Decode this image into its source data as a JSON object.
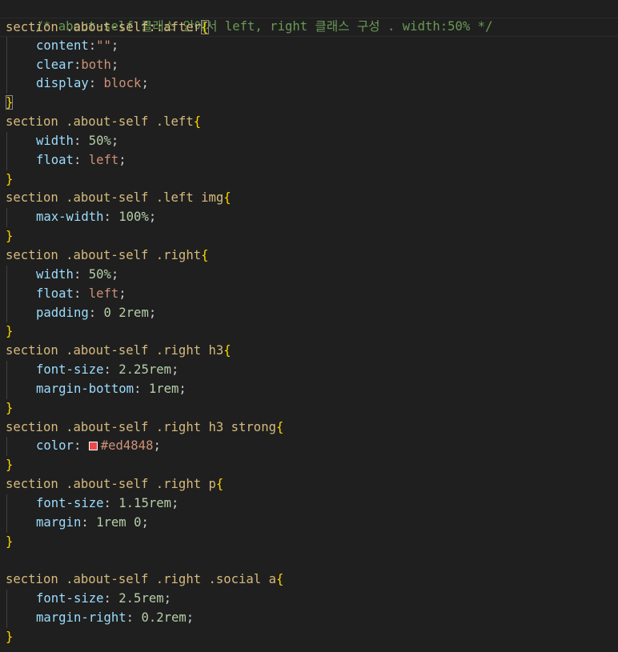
{
  "code": {
    "comment": "/* about-self 클래스 안에서 left, right 클래스 구성 . width:50% */",
    "rules": [
      {
        "selector": "section .about-self::after",
        "decls": [
          {
            "prop": "content",
            "sep": ":",
            "value": "\"\"",
            "vtype": "val"
          },
          {
            "prop": "clear",
            "sep": ":",
            "value": "both",
            "vtype": "val"
          },
          {
            "prop": "display",
            "sep": ": ",
            "value": "block",
            "vtype": "val"
          }
        ]
      },
      {
        "selector": "section .about-self .left",
        "decls": [
          {
            "prop": "width",
            "sep": ": ",
            "value": "50%",
            "vtype": "num"
          },
          {
            "prop": "float",
            "sep": ": ",
            "value": "left",
            "vtype": "val"
          }
        ]
      },
      {
        "selector": "section .about-self .left img",
        "decls": [
          {
            "prop": "max-width",
            "sep": ": ",
            "value": "100%",
            "vtype": "num"
          }
        ]
      },
      {
        "selector": "section .about-self .right",
        "decls": [
          {
            "prop": "width",
            "sep": ": ",
            "value": "50%",
            "vtype": "num"
          },
          {
            "prop": "float",
            "sep": ": ",
            "value": "left",
            "vtype": "val"
          },
          {
            "prop": "padding",
            "sep": ": ",
            "value": "0 2rem",
            "vtype": "num"
          }
        ]
      },
      {
        "selector": "section .about-self .right h3",
        "decls": [
          {
            "prop": "font-size",
            "sep": ": ",
            "value": "2.25rem",
            "vtype": "num"
          },
          {
            "prop": "margin-bottom",
            "sep": ": ",
            "value": "1rem",
            "vtype": "num"
          }
        ]
      },
      {
        "selector": "section .about-self .right h3 strong",
        "decls": [
          {
            "prop": "color",
            "sep": ": ",
            "value": "#ed4848",
            "vtype": "val",
            "swatch": "#ed4848"
          }
        ]
      },
      {
        "selector": "section .about-self .right p",
        "decls": [
          {
            "prop": "font-size",
            "sep": ": ",
            "value": "1.15rem",
            "vtype": "num"
          },
          {
            "prop": "margin",
            "sep": ": ",
            "value": "1rem 0",
            "vtype": "num"
          }
        ]
      },
      {
        "blank_before": true,
        "selector": "section .about-self .right .social a",
        "decls": [
          {
            "prop": "font-size",
            "sep": ": ",
            "value": "2.5rem",
            "vtype": "num"
          },
          {
            "prop": "margin-right",
            "sep": ": ",
            "value": "0.2rem",
            "vtype": "num"
          }
        ]
      }
    ],
    "open_brace": "{",
    "close_brace": "}",
    "terminator": ";"
  },
  "colors": {
    "background": "#1f1f1f",
    "comment": "#6a9955",
    "selector": "#d7ba7d",
    "property": "#9cdcfe",
    "string_value": "#ce9178",
    "number_value": "#b5cea8",
    "brace": "#ffd700",
    "swatch": "#ed4848"
  }
}
